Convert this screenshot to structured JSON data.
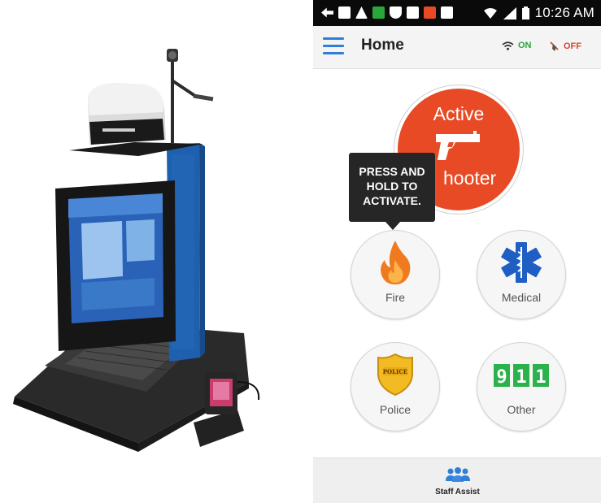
{
  "status_bar": {
    "time": "10:26 AM",
    "icons": [
      "back-icon",
      "image-icon",
      "warning-icon",
      "chat-icon",
      "shield-icon",
      "card-icon",
      "alert-icon",
      "mail-icon",
      "wifi-icon",
      "signal-icon",
      "battery-icon"
    ]
  },
  "app_bar": {
    "title": "Home",
    "wifi_status": "ON",
    "panic_status": "OFF"
  },
  "main": {
    "active_shooter": {
      "line1": "Active",
      "line2": "hooter"
    },
    "tooltip": {
      "line1": "PRESS AND",
      "line2": "HOLD TO",
      "line3": "ACTIVATE."
    },
    "buttons": [
      {
        "label": "Fire",
        "icon": "flame-icon"
      },
      {
        "label": "Medical",
        "icon": "star-of-life-icon"
      },
      {
        "label": "Police",
        "icon": "police-badge-icon"
      },
      {
        "label": "Other",
        "icon": "911-icon"
      }
    ],
    "badge_text": "POLICE",
    "digits": [
      "9",
      "1",
      "1"
    ]
  },
  "bottom_bar": {
    "label": "Staff Assist",
    "icon": "staff-group-icon"
  },
  "colors": {
    "accent_blue": "#2f7fd8",
    "active_red": "#e84a25",
    "on_green": "#2aa63a",
    "off_red": "#d9432b"
  }
}
